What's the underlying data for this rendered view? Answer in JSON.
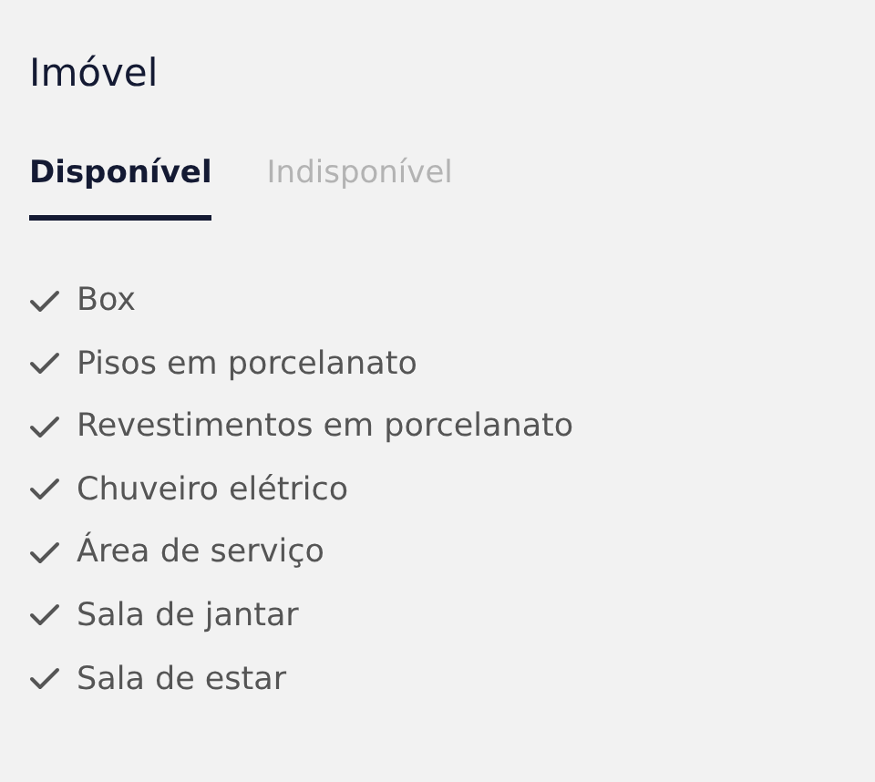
{
  "title": "Imóvel",
  "tabs": [
    {
      "label": "Disponível",
      "selected": true
    },
    {
      "label": "Indisponível",
      "selected": false
    }
  ],
  "features": [
    "Box",
    "Pisos em porcelanato",
    "Revestimentos em porcelanato",
    "Chuveiro elétrico",
    "Área de serviço",
    "Sala de jantar",
    "Sala de estar"
  ]
}
